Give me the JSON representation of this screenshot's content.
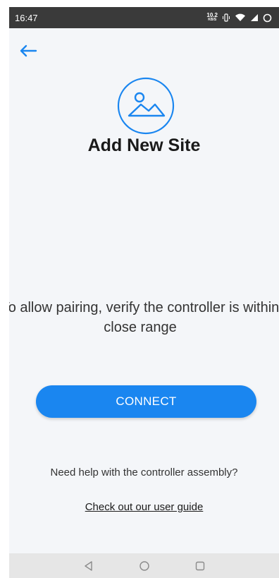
{
  "status_bar": {
    "time": "16:47",
    "net_speed_value": "10.2",
    "net_speed_unit": "KB/S",
    "icons": [
      "vibrate-icon",
      "wifi-icon",
      "signal-icon",
      "battery-icon"
    ]
  },
  "header": {
    "back_icon": "arrow-left-icon",
    "site_icon": "image-icon",
    "title": "Add New Site"
  },
  "main": {
    "instruction": "To allow pairing, verify the controller is within close range",
    "connect_label": "CONNECT",
    "help_text": "Need help with the controller assembly?",
    "guide_link": "Check out our user guide"
  },
  "nav_bar": {
    "buttons": [
      "back-triangle-icon",
      "home-circle-icon",
      "recents-square-icon"
    ]
  },
  "colors": {
    "accent": "#1a86f0",
    "background": "#f4f6f9",
    "status_bar": "#3a3a3a",
    "nav_bar": "#e6e6e6"
  }
}
